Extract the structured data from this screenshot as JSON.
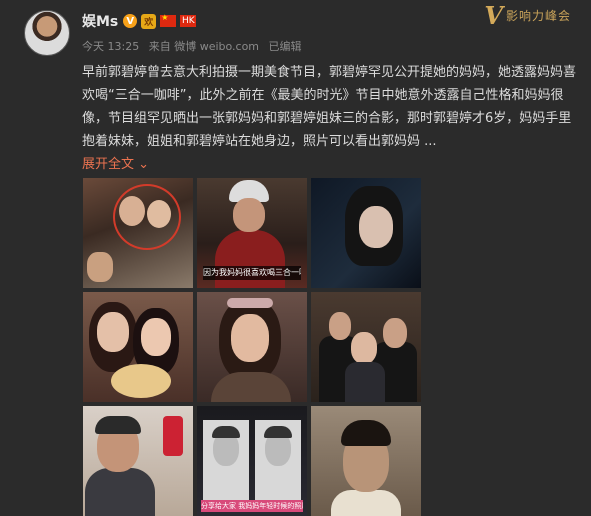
{
  "post": {
    "username": "娱Ms",
    "verified_badge": "V",
    "medal_label": "欢",
    "hk_flag_label": "HK",
    "time": "今天 13:25",
    "source": "来自 微博 weibo.com",
    "edited": "已编辑",
    "text": "早前郭碧婷曾去意大利拍摄一期美食节目，郭碧婷罕见公开提她的妈妈，她透露妈妈喜欢喝“三合一咖啡”，此外之前在《最美的时光》节目中她意外透露自己性格和妈妈很像，节目组罕见晒出一张郭妈妈和郭碧婷姐妹三的合影，那时郭碧婷才6岁，妈妈手里抱着妹妹，姐姐和郭碧婷站在她身边，照片可以看出郭妈妈 ...",
    "expand_label": "展开全文",
    "expand_arrow": "⌄"
  },
  "watermark": {
    "logo_letter": "V",
    "text": "影响力峰会"
  },
  "images": [
    {
      "caption": ""
    },
    {
      "caption": "因为我妈妈很喜欢喝三合一咖啡"
    },
    {
      "caption": ""
    },
    {
      "caption": ""
    },
    {
      "caption": ""
    },
    {
      "caption": ""
    },
    {
      "caption": ""
    },
    {
      "caption": "分享给大家 我妈妈年轻时候的照片"
    },
    {
      "caption": ""
    }
  ],
  "colors": {
    "background": "#2b2b2b",
    "link": "#eb7350",
    "meta_text": "#8a8a8a",
    "body_text": "#dcdcdc"
  }
}
